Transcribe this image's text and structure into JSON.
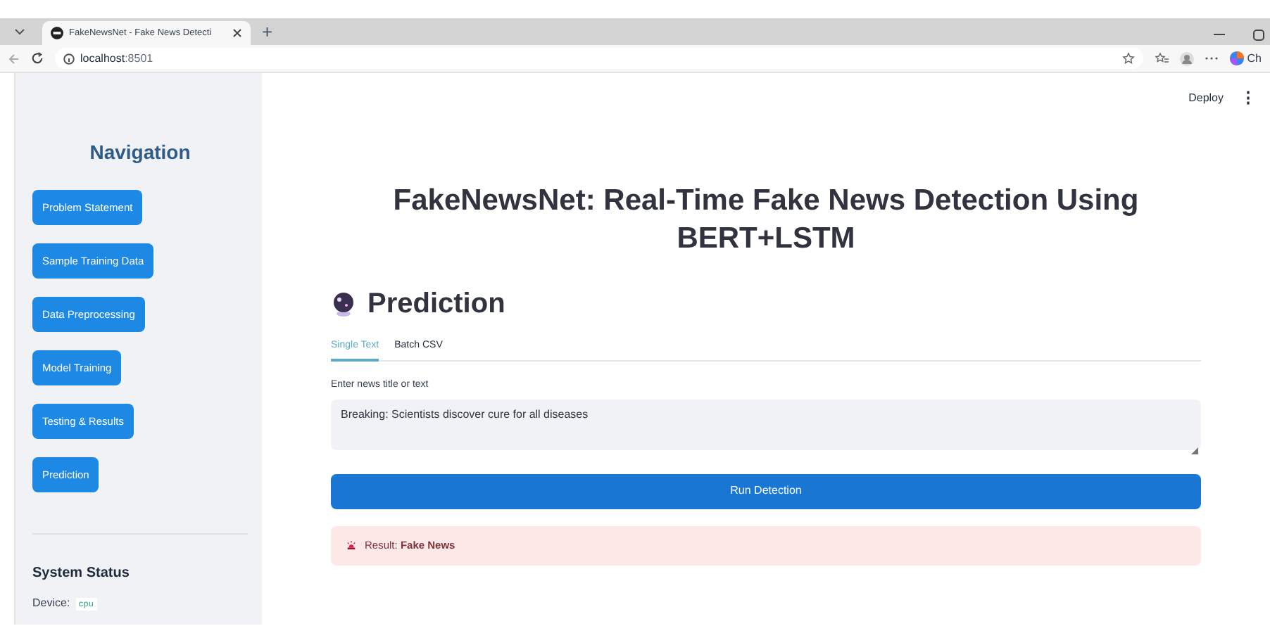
{
  "browser": {
    "tab_title": "FakeNewsNet - Fake News Detecti",
    "new_tab": "+",
    "url_host": "localhost",
    "url_port": ":8501",
    "copilot_label": "Ch"
  },
  "app_toolbar": {
    "deploy": "Deploy",
    "menu": "⋮"
  },
  "sidebar": {
    "title": "Navigation",
    "items": [
      {
        "label": "Problem Statement"
      },
      {
        "label": "Sample Training Data"
      },
      {
        "label": "Data Preprocessing"
      },
      {
        "label": "Model Training"
      },
      {
        "label": "Testing & Results"
      },
      {
        "label": "Prediction"
      }
    ],
    "status_title": "System Status",
    "device_label": "Device:",
    "device_value": "cpu"
  },
  "main": {
    "title": "FakeNewsNet: Real-Time Fake News Detection Using BERT+LSTM",
    "section_title": "Prediction",
    "tabs": [
      {
        "label": "Single Text",
        "selected": true
      },
      {
        "label": "Batch CSV",
        "selected": false
      }
    ],
    "input_label": "Enter news title or text",
    "input_value": "Breaking: Scientists discover cure for all diseases",
    "button": "Run Detection",
    "result": "Result: **Fake News**"
  }
}
